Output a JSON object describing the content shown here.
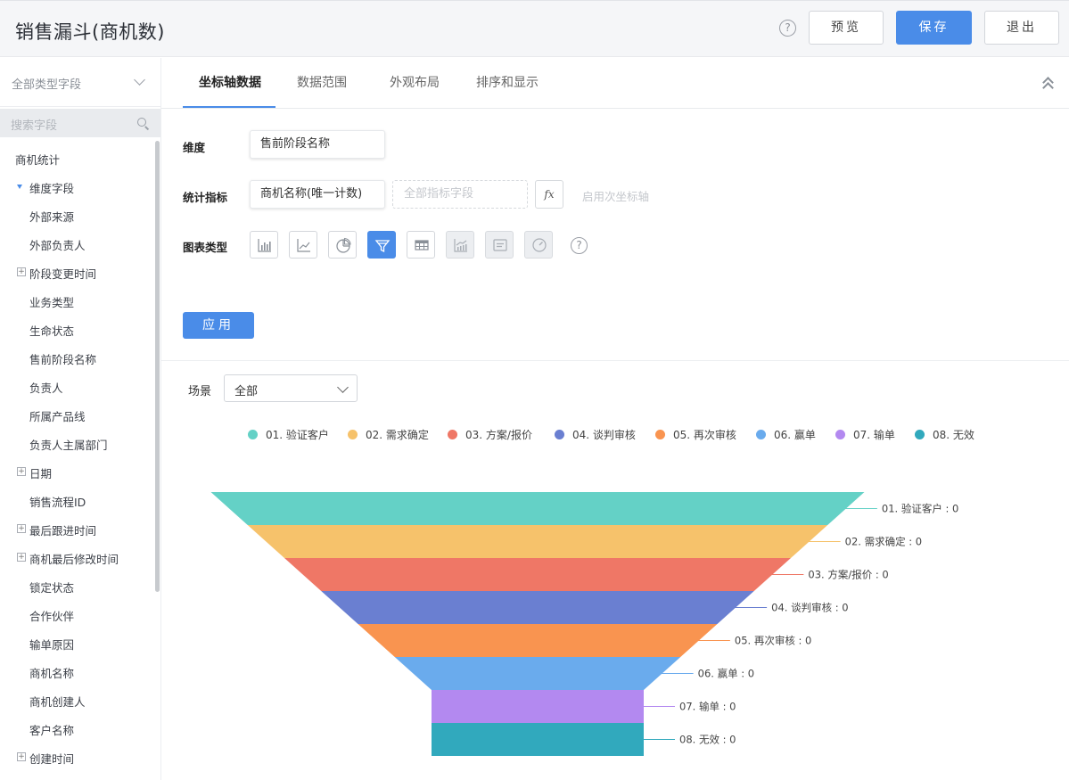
{
  "header": {
    "title": "销售漏斗(商机数)",
    "help_icon": "?",
    "preview_label": "预览",
    "save_label": "保存",
    "exit_label": "退出",
    "accent_color": "#4a8ce8"
  },
  "sidebar": {
    "field_type_select": "全部类型字段",
    "search_placeholder": "搜索字段",
    "tree": [
      {
        "label": "商机统计",
        "kind": "root"
      },
      {
        "label": "维度字段",
        "kind": "expanded"
      },
      {
        "label": "外部来源",
        "kind": "leaf"
      },
      {
        "label": "外部负责人",
        "kind": "leaf"
      },
      {
        "label": "阶段变更时间",
        "kind": "group"
      },
      {
        "label": "业务类型",
        "kind": "leaf"
      },
      {
        "label": "生命状态",
        "kind": "leaf"
      },
      {
        "label": "售前阶段名称",
        "kind": "leaf"
      },
      {
        "label": "负责人",
        "kind": "leaf"
      },
      {
        "label": "所属产品线",
        "kind": "leaf"
      },
      {
        "label": "负责人主属部门",
        "kind": "leaf"
      },
      {
        "label": "日期",
        "kind": "group"
      },
      {
        "label": "销售流程ID",
        "kind": "leaf"
      },
      {
        "label": "最后跟进时间",
        "kind": "group"
      },
      {
        "label": "商机最后修改时间",
        "kind": "group"
      },
      {
        "label": "锁定状态",
        "kind": "leaf"
      },
      {
        "label": "合作伙伴",
        "kind": "leaf"
      },
      {
        "label": "输单原因",
        "kind": "leaf"
      },
      {
        "label": "商机名称",
        "kind": "leaf"
      },
      {
        "label": "商机创建人",
        "kind": "leaf"
      },
      {
        "label": "客户名称",
        "kind": "leaf"
      },
      {
        "label": "创建时间",
        "kind": "group"
      }
    ]
  },
  "tabs": [
    {
      "label": "坐标轴数据",
      "active": true
    },
    {
      "label": "数据范围",
      "active": false
    },
    {
      "label": "外观布局",
      "active": false
    },
    {
      "label": "排序和显示",
      "active": false
    }
  ],
  "config": {
    "dimension_label": "维度",
    "dimension_value": "售前阶段名称",
    "metric_label": "统计指标",
    "metric_value": "商机名称(唯一计数)",
    "metric_placeholder": "全部指标字段",
    "fx_label": "fx",
    "secondary_axis_label": "启用次坐标轴",
    "chart_type_label": "图表类型",
    "chart_types": [
      {
        "icon": "bar-chart-icon",
        "state": "normal"
      },
      {
        "icon": "line-chart-icon",
        "state": "normal"
      },
      {
        "icon": "pie-chart-icon",
        "state": "normal"
      },
      {
        "icon": "funnel-chart-icon",
        "state": "selected"
      },
      {
        "icon": "table-chart-icon",
        "state": "normal"
      },
      {
        "icon": "combo-chart-icon",
        "state": "disabled"
      },
      {
        "icon": "text-card-icon",
        "state": "disabled"
      },
      {
        "icon": "gauge-chart-icon",
        "state": "disabled"
      }
    ],
    "apply_label": "应用"
  },
  "scene": {
    "label": "场景",
    "value": "全部"
  },
  "chart_data": {
    "type": "funnel",
    "categories": [
      "01. 验证客户",
      "02. 需求确定",
      "03. 方案/报价",
      "04. 谈判审核",
      "05. 再次审核",
      "06. 赢单",
      "07. 输单",
      "08. 无效"
    ],
    "values": [
      0,
      0,
      0,
      0,
      0,
      0,
      0,
      0
    ],
    "colors": [
      "#64d1c6",
      "#f6c26b",
      "#ef7766",
      "#6a7fd1",
      "#f99450",
      "#6aabed",
      "#b389f0",
      "#31a9bd"
    ],
    "legend_position": "top"
  }
}
